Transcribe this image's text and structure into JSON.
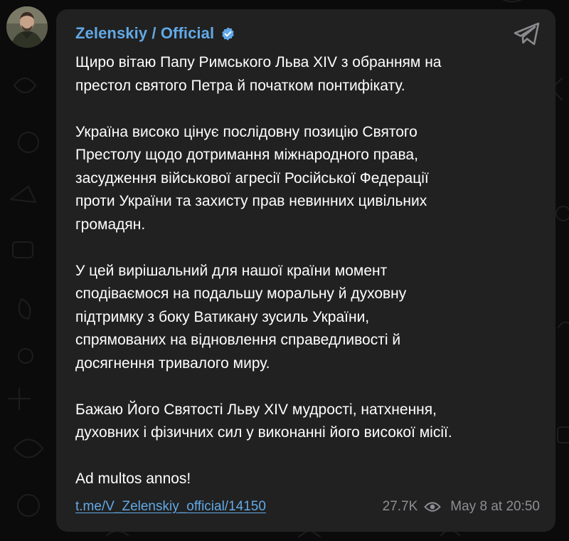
{
  "channel": {
    "name": "Zelenskiy / Official",
    "verified": true,
    "accent_color": "#62a9e6"
  },
  "post": {
    "paragraphs": [
      "Щиро вітаю Папу Римського Льва XIV з обранням на\nпрестол святого Петра й початком понтифікату.",
      "Україна високо цінує послідовну позицію Святого\nПрестолу щодо дотримання міжнародного права,\nзасудження військової агресії Російської Федерації\nпроти України та захисту прав невинних цивільних\nгромадян.",
      "У цей вирішальний для нашої країни момент\nсподіваємося на подальшу моральну й духовну\nпідтримку з боку Ватикану зусиль України,\nспрямованих на відновлення справедливості й\nдосягнення тривалого миру.",
      "Бажаю Його Святості Льву XIV мудрості, натхнення,\nдуховних і фізичних сил у виконанні його високої місії.",
      "Ad multos annos!"
    ],
    "link": "t.me/V_Zelenskiy_official/14150",
    "views": "27.7K",
    "timestamp": "May 8 at 20:50"
  },
  "icons": {
    "verified": "verified-badge-icon",
    "share": "telegram-share-icon",
    "views": "eye-icon"
  },
  "colors": {
    "background": "#0b0b0c",
    "bubble": "#212121",
    "text": "#ffffff",
    "meta": "#8e8e93"
  }
}
